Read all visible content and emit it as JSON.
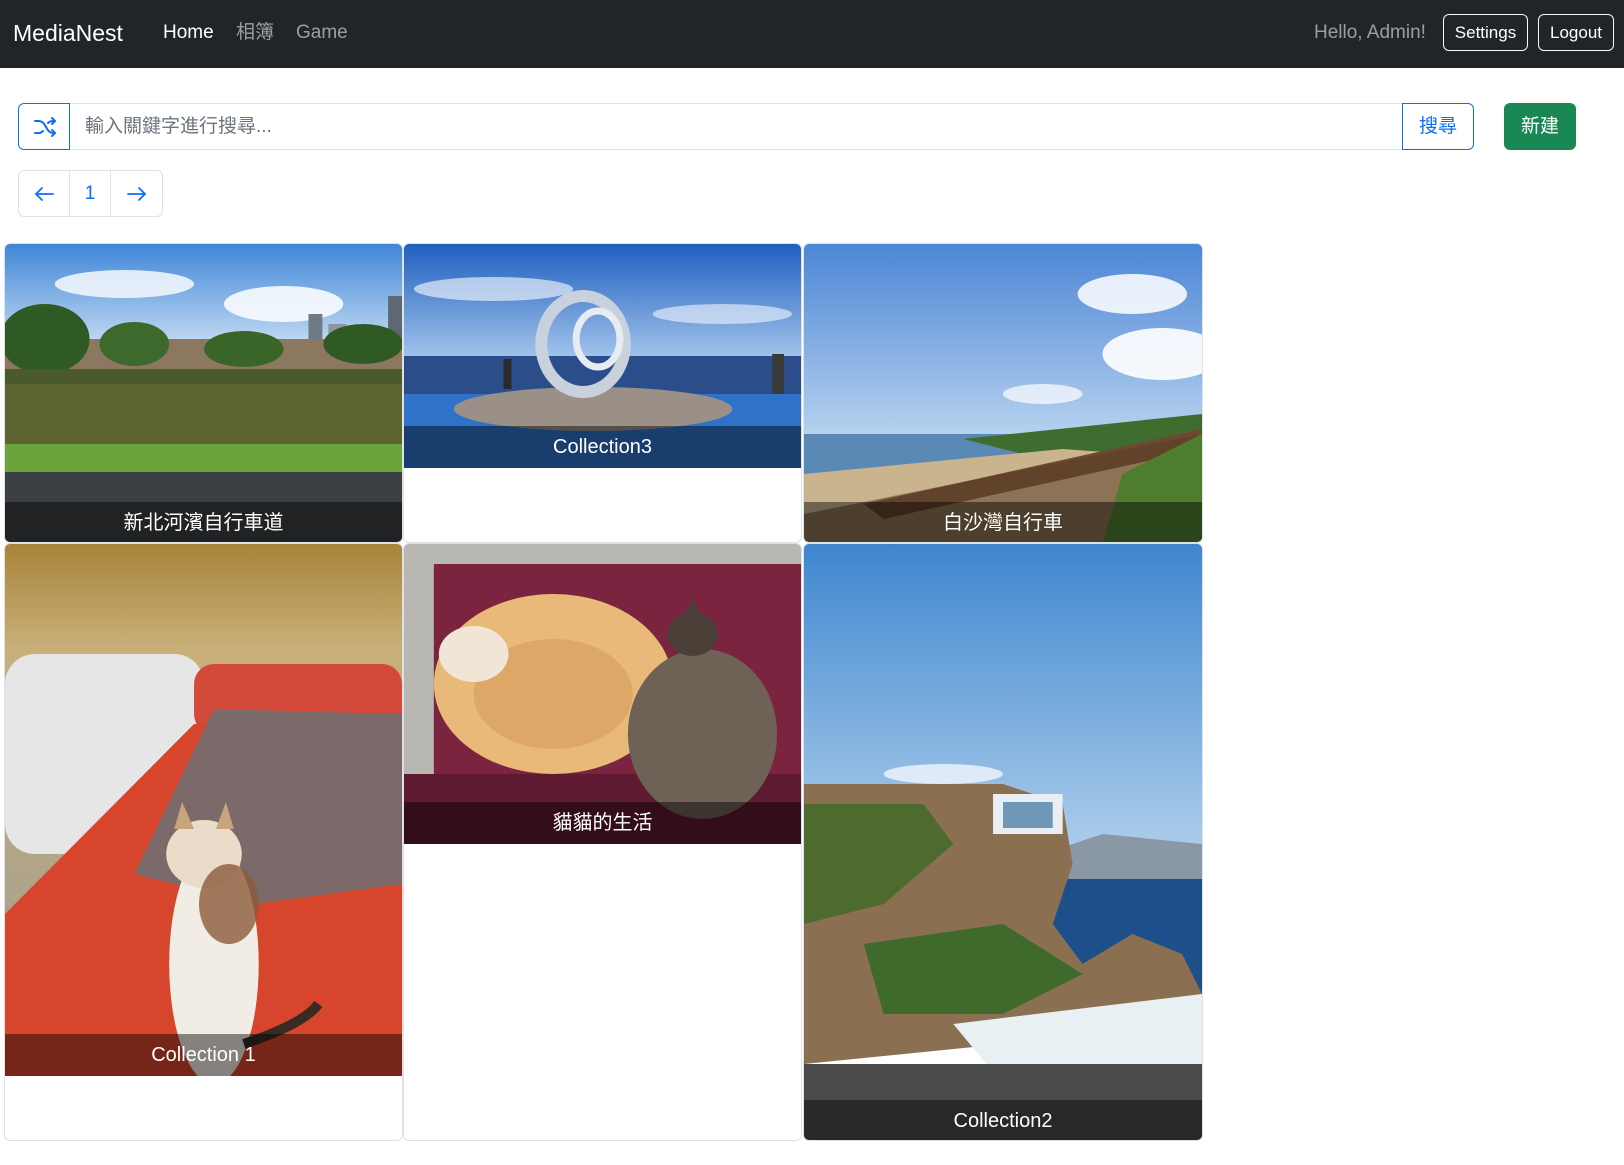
{
  "navbar": {
    "brand": "MediaNest",
    "links": [
      {
        "label": "Home",
        "active": true
      },
      {
        "label": "相簿",
        "active": false
      },
      {
        "label": "Game",
        "active": false
      }
    ],
    "greeting": "Hello, Admin!",
    "settings_label": "Settings",
    "logout_label": "Logout"
  },
  "search": {
    "shuffle_icon": "shuffle-icon",
    "placeholder": "輸入關鍵字進行搜尋...",
    "value": "",
    "button_label": "搜尋"
  },
  "create_button": {
    "label": "新建",
    "color": "#198754"
  },
  "pagination": {
    "prev_icon": "arrow-left-icon",
    "current_page": "1",
    "next_icon": "arrow-right-icon"
  },
  "collections": [
    {
      "title": "新北河濱自行車道",
      "image": "riverside lotus field with city buildings"
    },
    {
      "title": "Collection3",
      "image": "seaside ring sculpture on blue platform"
    },
    {
      "title": "白沙灣自行車",
      "image": "coastal wooden boardwalk by the beach"
    },
    {
      "title": "Collection 1",
      "image": "cat sitting on red car hood"
    },
    {
      "title": "貓貓的生活",
      "image": "two cats sleeping on a blanket"
    },
    {
      "title": "Collection2",
      "image": "cliffside balcony over the sea"
    }
  ],
  "colors": {
    "navbar_bg": "#212529",
    "primary": "#0d6efd",
    "success": "#198754",
    "border": "#dee2e6"
  }
}
